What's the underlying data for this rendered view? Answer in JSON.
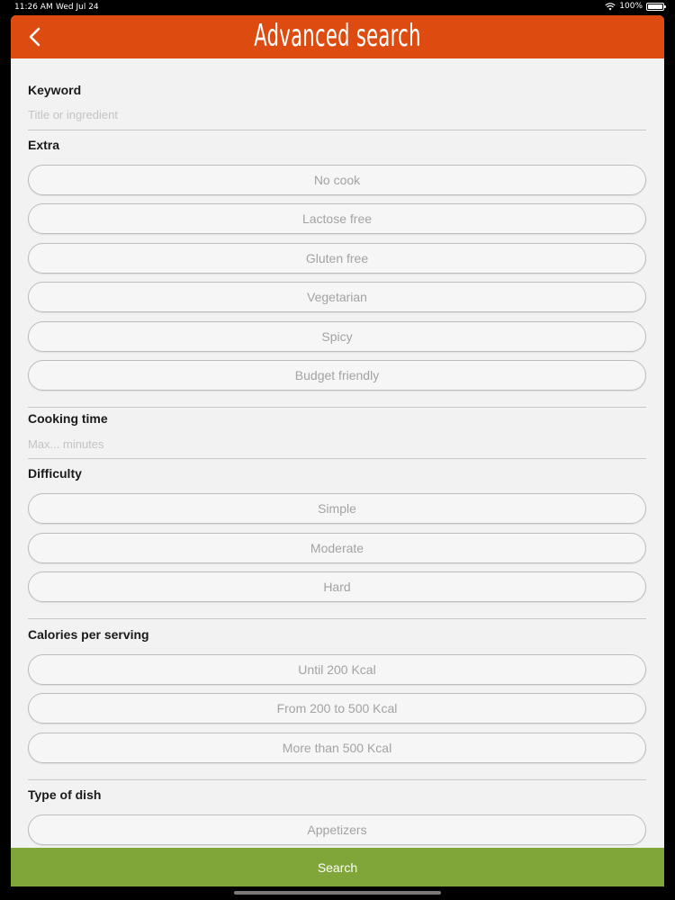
{
  "status_bar": {
    "time": "11:26 AM",
    "date": "Wed Jul 24",
    "battery": "100%",
    "battery_level": 1.0
  },
  "navbar": {
    "title": "Advanced search",
    "accent": "#de4b10"
  },
  "keyword": {
    "label": "Keyword",
    "placeholder": "Title or ingredient"
  },
  "extra": {
    "label": "Extra",
    "options": [
      "No cook",
      "Lactose free",
      "Gluten free",
      "Vegetarian",
      "Spicy",
      "Budget friendly"
    ]
  },
  "cooking_time": {
    "label": "Cooking time",
    "placeholder": "Max... minutes"
  },
  "difficulty": {
    "label": "Difficulty",
    "options": [
      "Simple",
      "Moderate",
      "Hard"
    ]
  },
  "calories": {
    "label": "Calories per serving",
    "options": [
      "Until 200 Kcal",
      "From 200 to 500 Kcal",
      "More than 500 Kcal"
    ]
  },
  "type_of_dish": {
    "label": "Type of dish",
    "options": [
      "Appetizers"
    ]
  },
  "search_button": {
    "label": "Search",
    "color": "#80a63a"
  }
}
